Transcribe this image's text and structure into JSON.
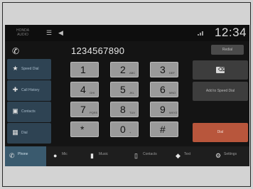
{
  "status": {
    "app_label": "HONDA\nAUDIO",
    "clock": "12:34",
    "signal_small": "",
    "icons": [
      "menu-icon",
      "volume-icon",
      "signal-icon"
    ]
  },
  "dial": {
    "number": "1234567890",
    "top_button": "Redial"
  },
  "side_menu": [
    {
      "label": "Speed Dial",
      "icon": "star-icon"
    },
    {
      "label": "Call History",
      "icon": "history-icon"
    },
    {
      "label": "Contacts",
      "icon": "contacts-icon"
    },
    {
      "label": "Dial",
      "icon": "keypad-icon"
    }
  ],
  "keypad": [
    {
      "digit": "1",
      "letters": ""
    },
    {
      "digit": "2",
      "letters": "ABC"
    },
    {
      "digit": "3",
      "letters": "DEF"
    },
    {
      "digit": "4",
      "letters": "GHI"
    },
    {
      "digit": "5",
      "letters": "JKL"
    },
    {
      "digit": "6",
      "letters": "MNO"
    },
    {
      "digit": "7",
      "letters": "PQRS"
    },
    {
      "digit": "8",
      "letters": "TUV"
    },
    {
      "digit": "9",
      "letters": "WXYZ"
    },
    {
      "digit": "*",
      "letters": ""
    },
    {
      "digit": "0",
      "letters": "+"
    },
    {
      "digit": "#",
      "letters": ""
    }
  ],
  "right_buttons": {
    "backspace": "⌫",
    "speed_dial": "Add to Speed Dial",
    "dial": "Dial"
  },
  "bottom_tabs": [
    {
      "label": "Phone",
      "icon": "phone-icon"
    },
    {
      "label": "Mic",
      "icon": "mic-icon"
    },
    {
      "label": "Music",
      "icon": "music-icon"
    },
    {
      "label": "Contacts",
      "icon": "device-icon"
    },
    {
      "label": "Text",
      "icon": "text-icon"
    },
    {
      "label": "Settings",
      "icon": "settings-icon"
    }
  ],
  "colors": {
    "accent_dial": "#b8563c",
    "side_menu": "#2e4353",
    "active_tab": "#3a5a6e"
  }
}
